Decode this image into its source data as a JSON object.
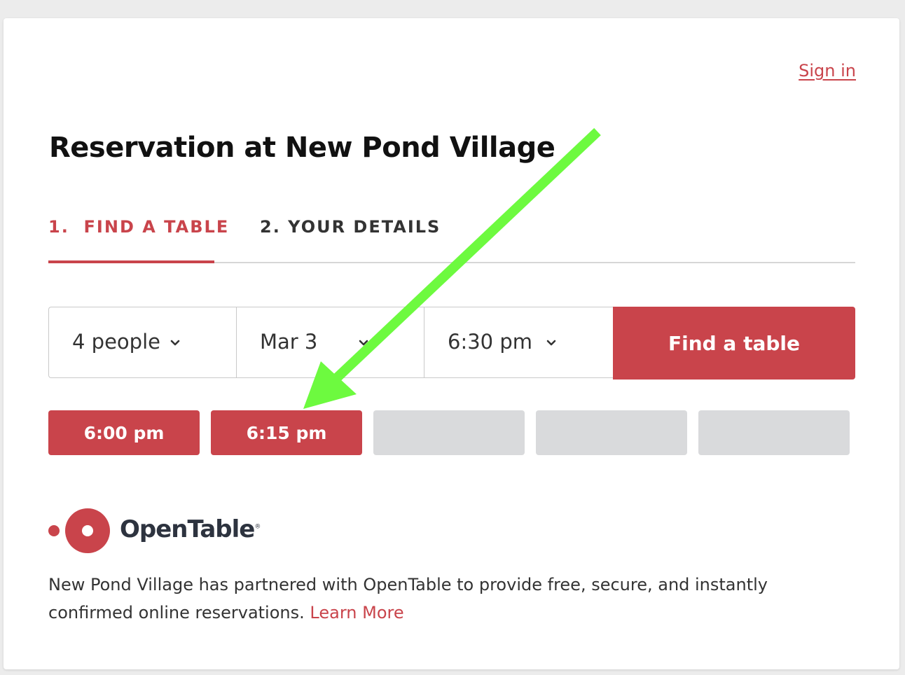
{
  "header": {
    "sign_in": "Sign in"
  },
  "title": "Reservation at New Pond Village",
  "tabs": [
    {
      "label": "1.  FIND A TABLE",
      "active": true
    },
    {
      "label": "2. YOUR DETAILS",
      "active": false
    }
  ],
  "search": {
    "party_size": "4 people",
    "date": "Mar 3",
    "time": "6:30 pm",
    "submit_label": "Find a table"
  },
  "time_slots": [
    {
      "label": "6:00 pm",
      "available": true
    },
    {
      "label": "6:15 pm",
      "available": true
    },
    {
      "label": "",
      "available": false
    },
    {
      "label": "",
      "available": false
    },
    {
      "label": "",
      "available": false
    }
  ],
  "brand": {
    "name": "OpenTable",
    "registered_mark": "®"
  },
  "footer": {
    "description": "New Pond Village has partnered with OpenTable to provide free, secure, and instantly confirmed online reservations.",
    "learn_more": "Learn More"
  },
  "colors": {
    "accent": "#c9444b",
    "disabled_slot": "#d9dadc",
    "annotation_arrow": "#6dfa3f"
  },
  "icons": {
    "dropdown": "chevron-down-icon",
    "annotation": "arrow-icon"
  }
}
